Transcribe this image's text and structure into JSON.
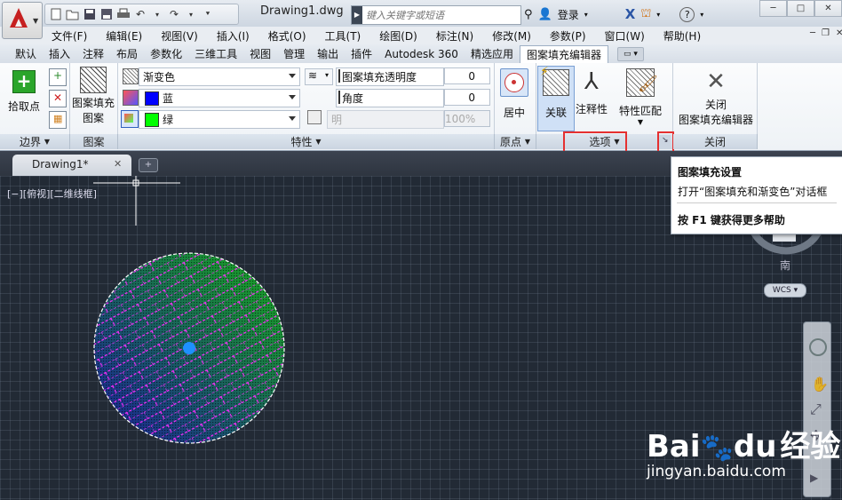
{
  "title_bar": {
    "document_title": "Drawing1.dwg",
    "search_placeholder": "键入关键字或短语",
    "login_label": "登录",
    "quick_access_icons": [
      "new-icon",
      "open-icon",
      "save-icon",
      "save-as-icon",
      "print-icon",
      "undo-icon",
      "redo-icon",
      "dropdown-icon"
    ]
  },
  "menu": [
    "文件(F)",
    "编辑(E)",
    "视图(V)",
    "插入(I)",
    "格式(O)",
    "工具(T)",
    "绘图(D)",
    "标注(N)",
    "修改(M)",
    "参数(P)",
    "窗口(W)",
    "帮助(H)"
  ],
  "ribbon_tabs": [
    "默认",
    "插入",
    "注释",
    "布局",
    "参数化",
    "三维工具",
    "视图",
    "管理",
    "输出",
    "插件",
    "Autodesk 360",
    "精选应用",
    "图案填充编辑器"
  ],
  "active_tab_index": 12,
  "ribbon": {
    "boundary": {
      "pick_points": "拾取点",
      "title": "边界"
    },
    "pattern": {
      "label_line1": "图案填充",
      "label_line2": "图案",
      "title": "图案"
    },
    "properties": {
      "type": "渐变色",
      "color1": {
        "name": "蓝",
        "hex": "#0000ff"
      },
      "color2": {
        "name": "绿",
        "hex": "#00ff00"
      },
      "transparency_label": "图案填充透明度",
      "transparency_value": "0",
      "angle_label": "角度",
      "angle_value": "0",
      "tint_label": "明",
      "tint_value": "100%",
      "title": "特性"
    },
    "origin": {
      "center": "居中",
      "title": "原点"
    },
    "options": {
      "associative": "关联",
      "annotative": "注释性",
      "match_properties": "特性匹配",
      "title": "选项"
    },
    "close": {
      "line1": "关闭",
      "line2": "图案填充编辑器",
      "title": "关闭"
    }
  },
  "doc_tab": {
    "name": "Drawing1*"
  },
  "viewport_label": "[−][俯视][二维线框]",
  "tooltip": {
    "title": "图案填充设置",
    "description": "打开“图案填充和渐变色”对话框",
    "help": "按 F1 键获得更多帮助"
  },
  "nav": {
    "south": "南",
    "wcs": "WCS"
  },
  "watermark": {
    "brand": "Bai",
    "brand2": "du",
    "cn": "经验",
    "url": "jingyan.baidu.com"
  },
  "colors": {
    "accent_red": "#e53030",
    "canvas": "#222a35",
    "grip_blue": "#1e90ff",
    "hatch_magenta": "#ff2bff"
  }
}
